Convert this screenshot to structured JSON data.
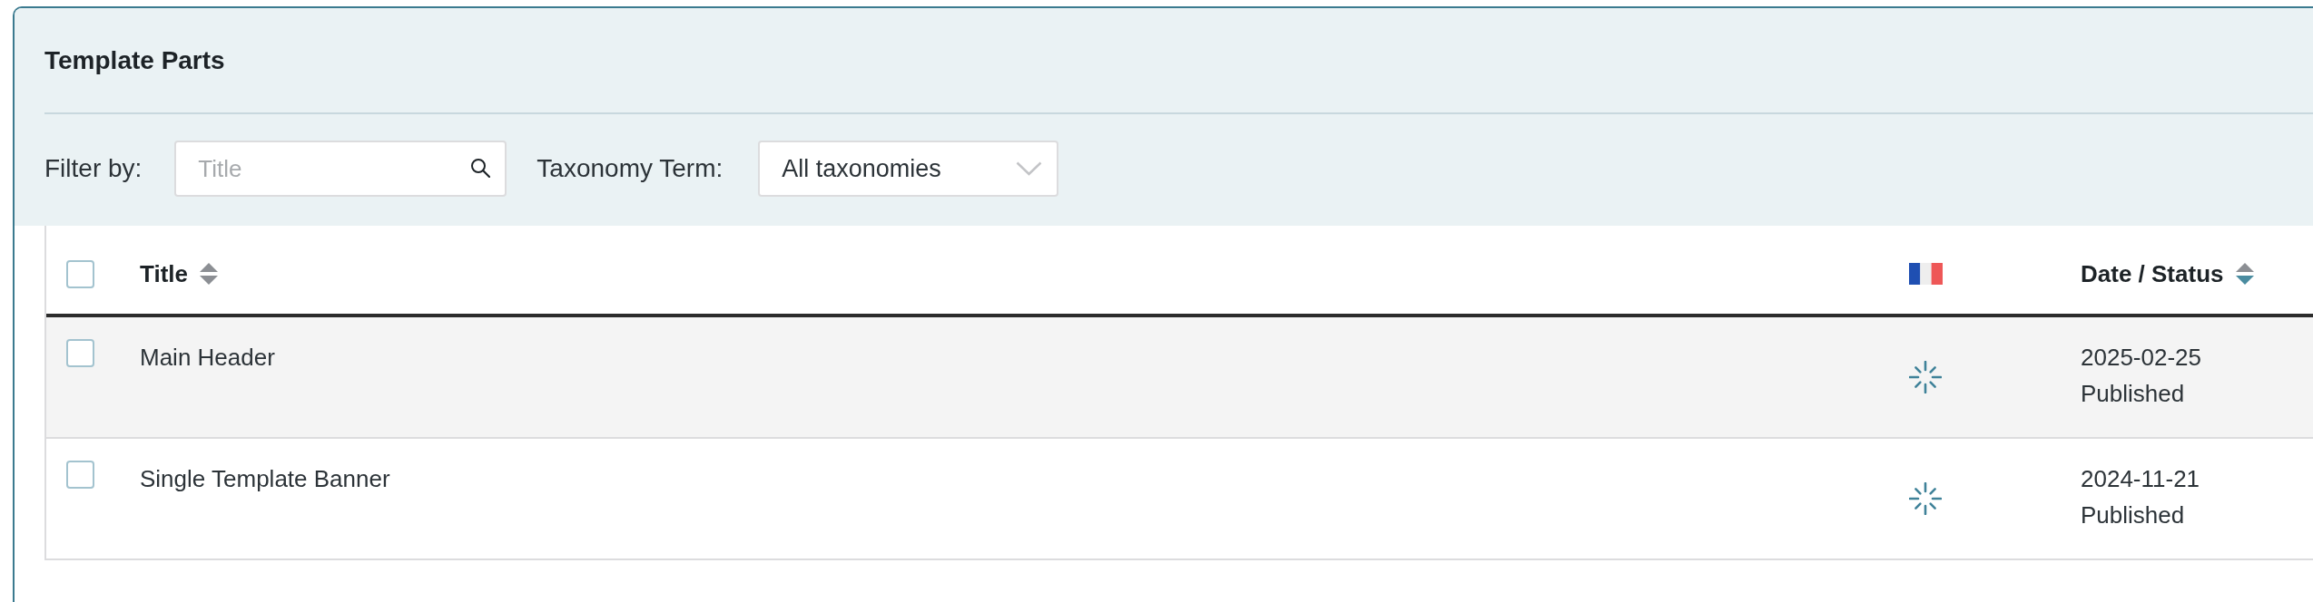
{
  "panel": {
    "title": "Template Parts"
  },
  "filters": {
    "label": "Filter by:",
    "search": {
      "placeholder": "Title"
    },
    "taxonomy": {
      "label": "Taxonomy Term:",
      "value": "All taxonomies"
    }
  },
  "table": {
    "select_all": {
      "checked": false
    },
    "columns": [
      {
        "kind": "text",
        "label": "Title",
        "sorted": false
      },
      {
        "kind": "language"
      },
      {
        "kind": "date",
        "label": "Date / Status",
        "sorted": true
      }
    ],
    "rows": [
      {
        "checked": false,
        "title": "Main Header",
        "date": "2025-02-25",
        "status": "Published"
      },
      {
        "checked": false,
        "title": "Single Template Banner",
        "date": "2024-11-21",
        "status": "Published"
      }
    ]
  }
}
